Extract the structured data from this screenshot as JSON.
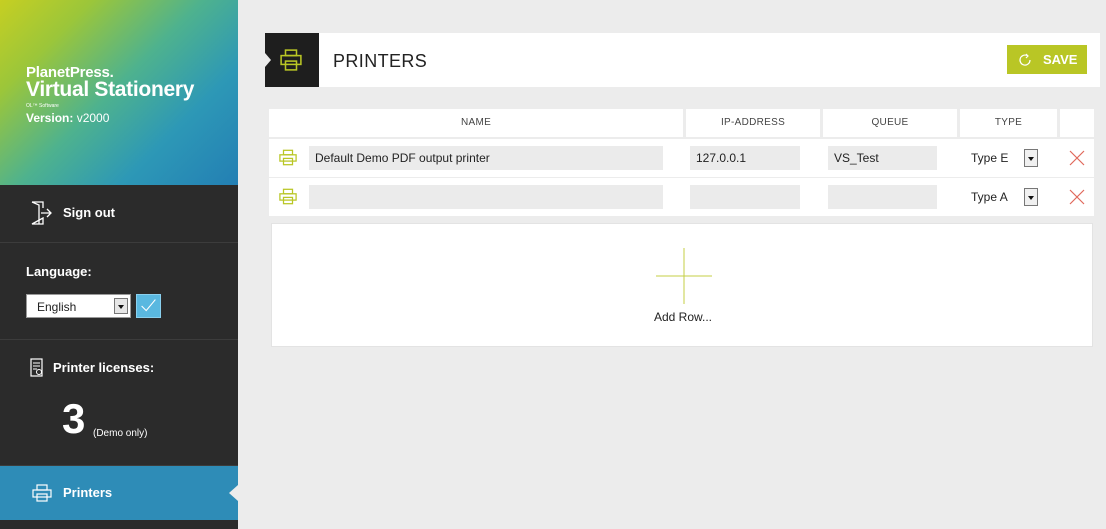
{
  "brand": {
    "line1": "PlanetPress.",
    "line2": "Virtual Stationery",
    "sub": "OL™ Software",
    "version_label": "Version:",
    "version_value": "v2000"
  },
  "sidebar": {
    "signout_label": "Sign out",
    "language_label": "Language:",
    "language_selected": "English",
    "licenses_label": "Printer licenses:",
    "licenses_count": "3",
    "licenses_note": "(Demo only)",
    "nav_printers_label": "Printers"
  },
  "header": {
    "title": "PRINTERS",
    "save_label": "SAVE"
  },
  "table": {
    "columns": [
      "NAME",
      "IP-ADDRESS",
      "QUEUE",
      "TYPE"
    ],
    "rows": [
      {
        "name": "Default Demo PDF output printer",
        "ip": "127.0.0.1",
        "queue": "VS_Test",
        "type": "Type E"
      },
      {
        "name": "",
        "ip": "",
        "queue": "",
        "type": "Type A"
      }
    ],
    "add_row_label": "Add Row..."
  },
  "colors": {
    "accent_green": "#b9c625",
    "accent_blue": "#2e8cb7",
    "sidebar_bg": "#2b2b2b",
    "delete_red": "#e0685a"
  }
}
